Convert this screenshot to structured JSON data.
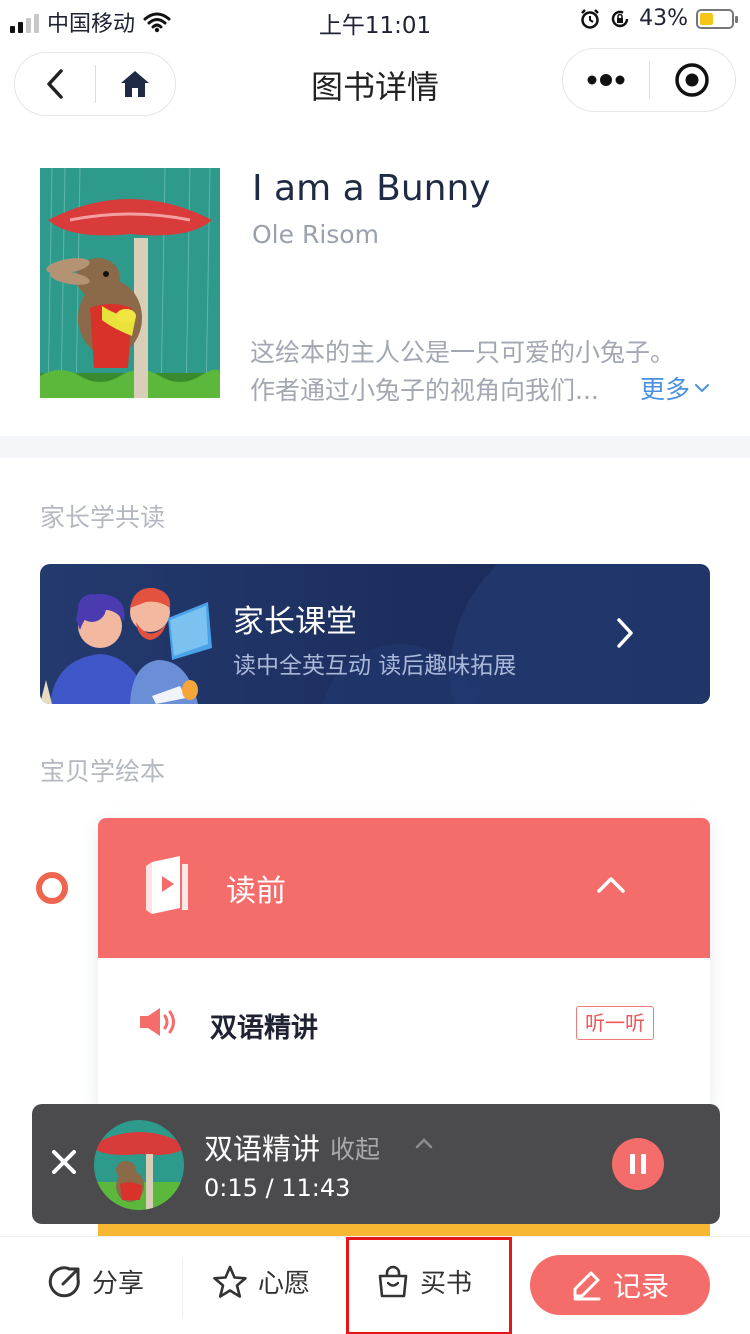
{
  "status_bar": {
    "carrier": "中国移动",
    "time": "上午11:01",
    "battery": "43%",
    "battery_level": 0.43
  },
  "nav": {
    "title": "图书详情"
  },
  "book": {
    "title": "I am a Bunny",
    "author": "Ole Risom",
    "desc_line1": "这绘本的主人公是一只可爱的小兔子。",
    "desc_line2": "作者通过小兔子的视角向我们...",
    "more": "更多"
  },
  "sections": {
    "parent_reading": "家长学共读",
    "baby_reading": "宝贝学绘本"
  },
  "banner": {
    "title": "家长课堂",
    "subtitle": "读中全英互动  读后趣味拓展"
  },
  "stage": {
    "title": "读前",
    "item_title": "双语精讲",
    "item_action": "听一听",
    "accent": "#f56d6b"
  },
  "player": {
    "title": "双语精讲",
    "collapse": "收起",
    "time": "0:15 / 11:43"
  },
  "bottom_bar": {
    "share": "分享",
    "wish": "心愿",
    "buy": "买书",
    "record": "记录"
  }
}
